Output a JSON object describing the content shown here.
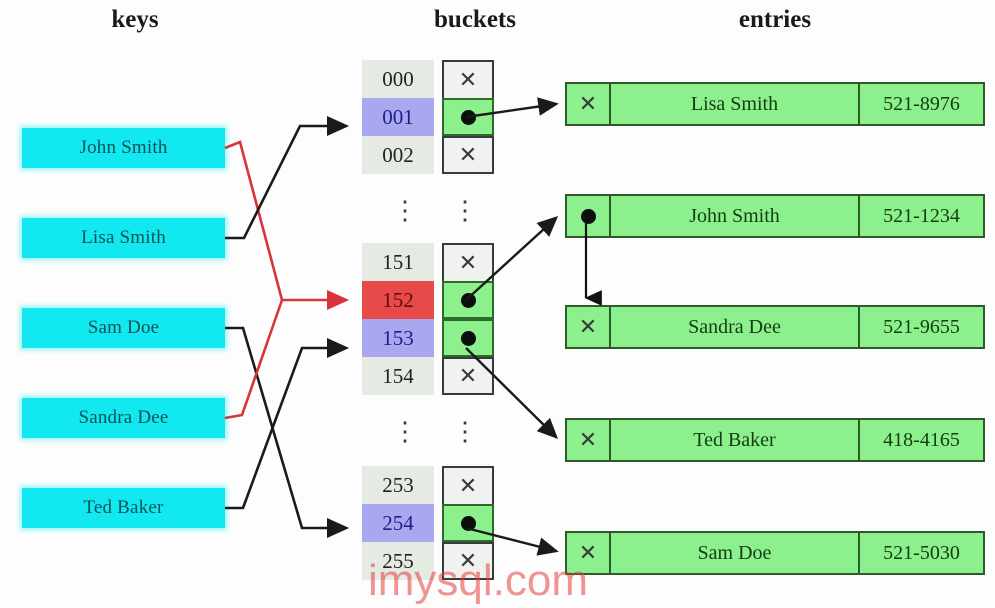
{
  "headers": {
    "keys": "keys",
    "buckets": "buckets",
    "entries": "entries"
  },
  "colors": {
    "key_box": "#11e8ef",
    "key_text": "#0c5257",
    "bucket_default": "#e5ebe3",
    "bucket_highlight_blue": "#a9a8ef",
    "bucket_highlight_red": "#e84a49",
    "pointer_filled": "#8cf08c",
    "pointer_empty": "#f0f2ef",
    "entry_fill": "#8cf08c",
    "entry_border": "#2c5c2c",
    "link_black": "#1a1a1a",
    "link_red": "#d6353a",
    "watermark": "#e43c3c"
  },
  "keys": [
    {
      "label": "John Smith"
    },
    {
      "label": "Lisa Smith"
    },
    {
      "label": "Sam Doe"
    },
    {
      "label": "Sandra Dee"
    },
    {
      "label": "Ted Baker"
    }
  ],
  "buckets": {
    "groups": [
      {
        "rows": [
          {
            "index": "000",
            "highlight": "none",
            "pointer": "empty",
            "icon": "x-icon"
          },
          {
            "index": "001",
            "highlight": "blue",
            "pointer": "filled",
            "icon": "dot-icon"
          },
          {
            "index": "002",
            "highlight": "none",
            "pointer": "empty",
            "icon": "x-icon"
          }
        ]
      },
      {
        "rows": [
          {
            "index": "151",
            "highlight": "none",
            "pointer": "empty",
            "icon": "x-icon"
          },
          {
            "index": "152",
            "highlight": "red",
            "pointer": "filled",
            "icon": "dot-icon"
          },
          {
            "index": "153",
            "highlight": "blue",
            "pointer": "filled",
            "icon": "dot-icon"
          },
          {
            "index": "154",
            "highlight": "none",
            "pointer": "empty",
            "icon": "x-icon"
          }
        ]
      },
      {
        "rows": [
          {
            "index": "253",
            "highlight": "none",
            "pointer": "empty",
            "icon": "x-icon"
          },
          {
            "index": "254",
            "highlight": "blue",
            "pointer": "filled",
            "icon": "dot-icon"
          },
          {
            "index": "255",
            "highlight": "none",
            "pointer": "empty",
            "icon": "x-icon"
          }
        ]
      }
    ],
    "ellipsis_glyph": "⋮"
  },
  "entries": [
    {
      "pointer": "x-icon",
      "name": "Lisa Smith",
      "phone": "521-8976"
    },
    {
      "pointer": "dot-icon",
      "name": "John Smith",
      "phone": "521-1234"
    },
    {
      "pointer": "x-icon",
      "name": "Sandra Dee",
      "phone": "521-9655"
    },
    {
      "pointer": "x-icon",
      "name": "Ted Baker",
      "phone": "418-4165"
    },
    {
      "pointer": "x-icon",
      "name": "Sam Doe",
      "phone": "521-5030"
    }
  ],
  "glyphs": {
    "x": "✕"
  },
  "watermark": "imysql.com"
}
